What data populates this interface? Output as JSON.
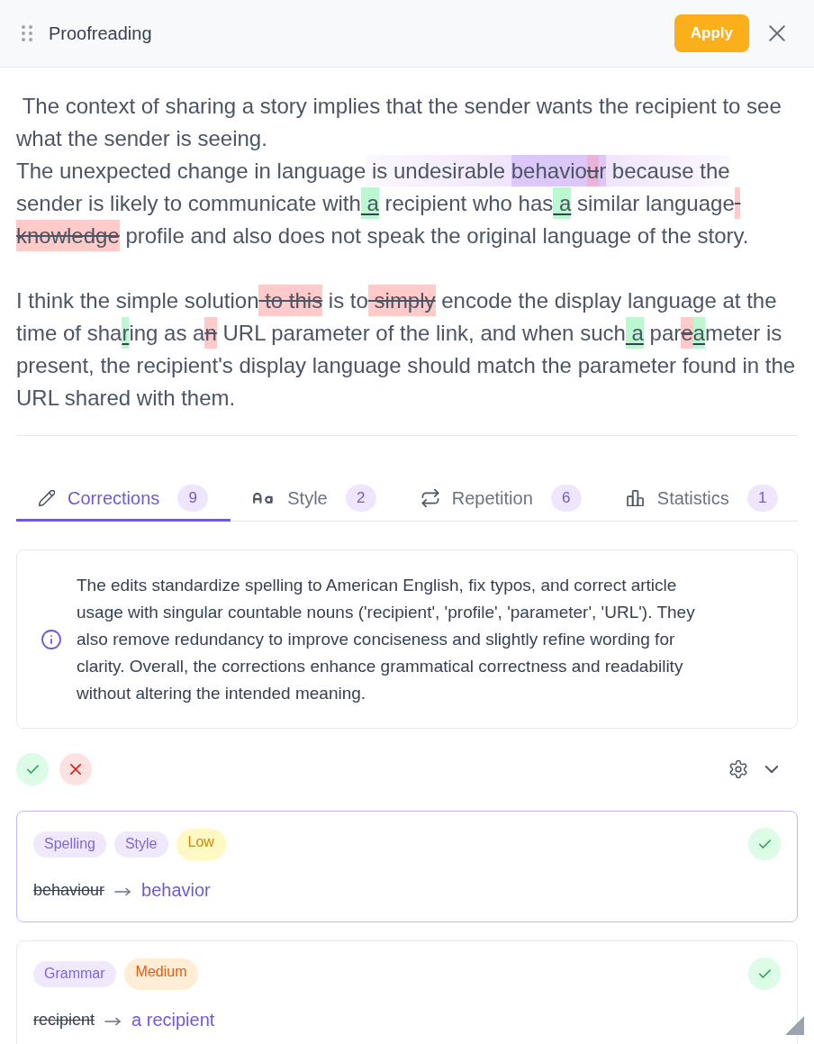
{
  "header": {
    "title": "Proofreading",
    "apply_button": "Apply"
  },
  "document": {
    "paragraphs": [
      {
        "segments": [
          {
            "kind": "plain",
            "text": " The context of sharing a story implies that the sender wants the recipient to see what the sender is seeing.\nThe unexpected change in language"
          },
          {
            "kind": "context",
            "text": " is undesirable "
          },
          {
            "kind": "focus",
            "text": "behavio"
          },
          {
            "kind": "delete",
            "text": "u"
          },
          {
            "kind": "focus",
            "text": "r"
          },
          {
            "kind": "context",
            "text": " because the"
          },
          {
            "kind": "plain",
            "text": " sender is likely to communicate with"
          },
          {
            "kind": "insert",
            "text": " a"
          },
          {
            "kind": "plain",
            "text": " recipient who has"
          },
          {
            "kind": "insert",
            "text": " a"
          },
          {
            "kind": "plain",
            "text": " similar language"
          },
          {
            "kind": "delete",
            "text": " knowledge"
          },
          {
            "kind": "plain",
            "text": " profile and also does not speak the original language of the story."
          }
        ]
      },
      {
        "segments": [
          {
            "kind": "plain",
            "text": "I think the simple solution"
          },
          {
            "kind": "delete",
            "text": " to this"
          },
          {
            "kind": "plain",
            "text": " is to"
          },
          {
            "kind": "delete",
            "text": " simply"
          },
          {
            "kind": "plain",
            "text": " encode the display language at the time of sha"
          },
          {
            "kind": "insert",
            "text": "r"
          },
          {
            "kind": "plain",
            "text": "ing as a"
          },
          {
            "kind": "delete",
            "text": "n"
          },
          {
            "kind": "plain",
            "text": " URL parameter of the link, and when such"
          },
          {
            "kind": "insert",
            "text": " a"
          },
          {
            "kind": "plain",
            "text": " par"
          },
          {
            "kind": "delete",
            "text": "e"
          },
          {
            "kind": "insert",
            "text": "a"
          },
          {
            "kind": "plain",
            "text": "meter is present, the recipient's display language should match the parameter found in the URL shared with them."
          }
        ]
      }
    ]
  },
  "tabs": [
    {
      "label": "Corrections",
      "count": "9",
      "selected": true
    },
    {
      "label": "Style",
      "count": "2",
      "selected": false
    },
    {
      "label": "Repetition",
      "count": "6",
      "selected": false
    },
    {
      "label": "Statistics",
      "count": "1",
      "selected": false
    }
  ],
  "summary": {
    "text": "The edits standardize spelling to American English, fix typos, and correct article usage with singular countable nouns ('recipient', 'profile', 'parameter', 'URL'). They also remove redundancy to improve conciseness and slightly refine wording for clarity. Overall, the corrections enhance grammatical correctness and readability without altering the intended meaning."
  },
  "corrections": [
    {
      "selected": true,
      "tags": [
        {
          "kind": "category",
          "label": "Spelling"
        },
        {
          "kind": "category",
          "label": "Style"
        },
        {
          "kind": "low",
          "label": "Low"
        }
      ],
      "original": "behaviour",
      "replacement": "behavior"
    },
    {
      "selected": false,
      "tags": [
        {
          "kind": "category",
          "label": "Grammar"
        },
        {
          "kind": "medium",
          "label": "Medium"
        }
      ],
      "original": "recipient",
      "replacement": "a recipient"
    }
  ]
}
